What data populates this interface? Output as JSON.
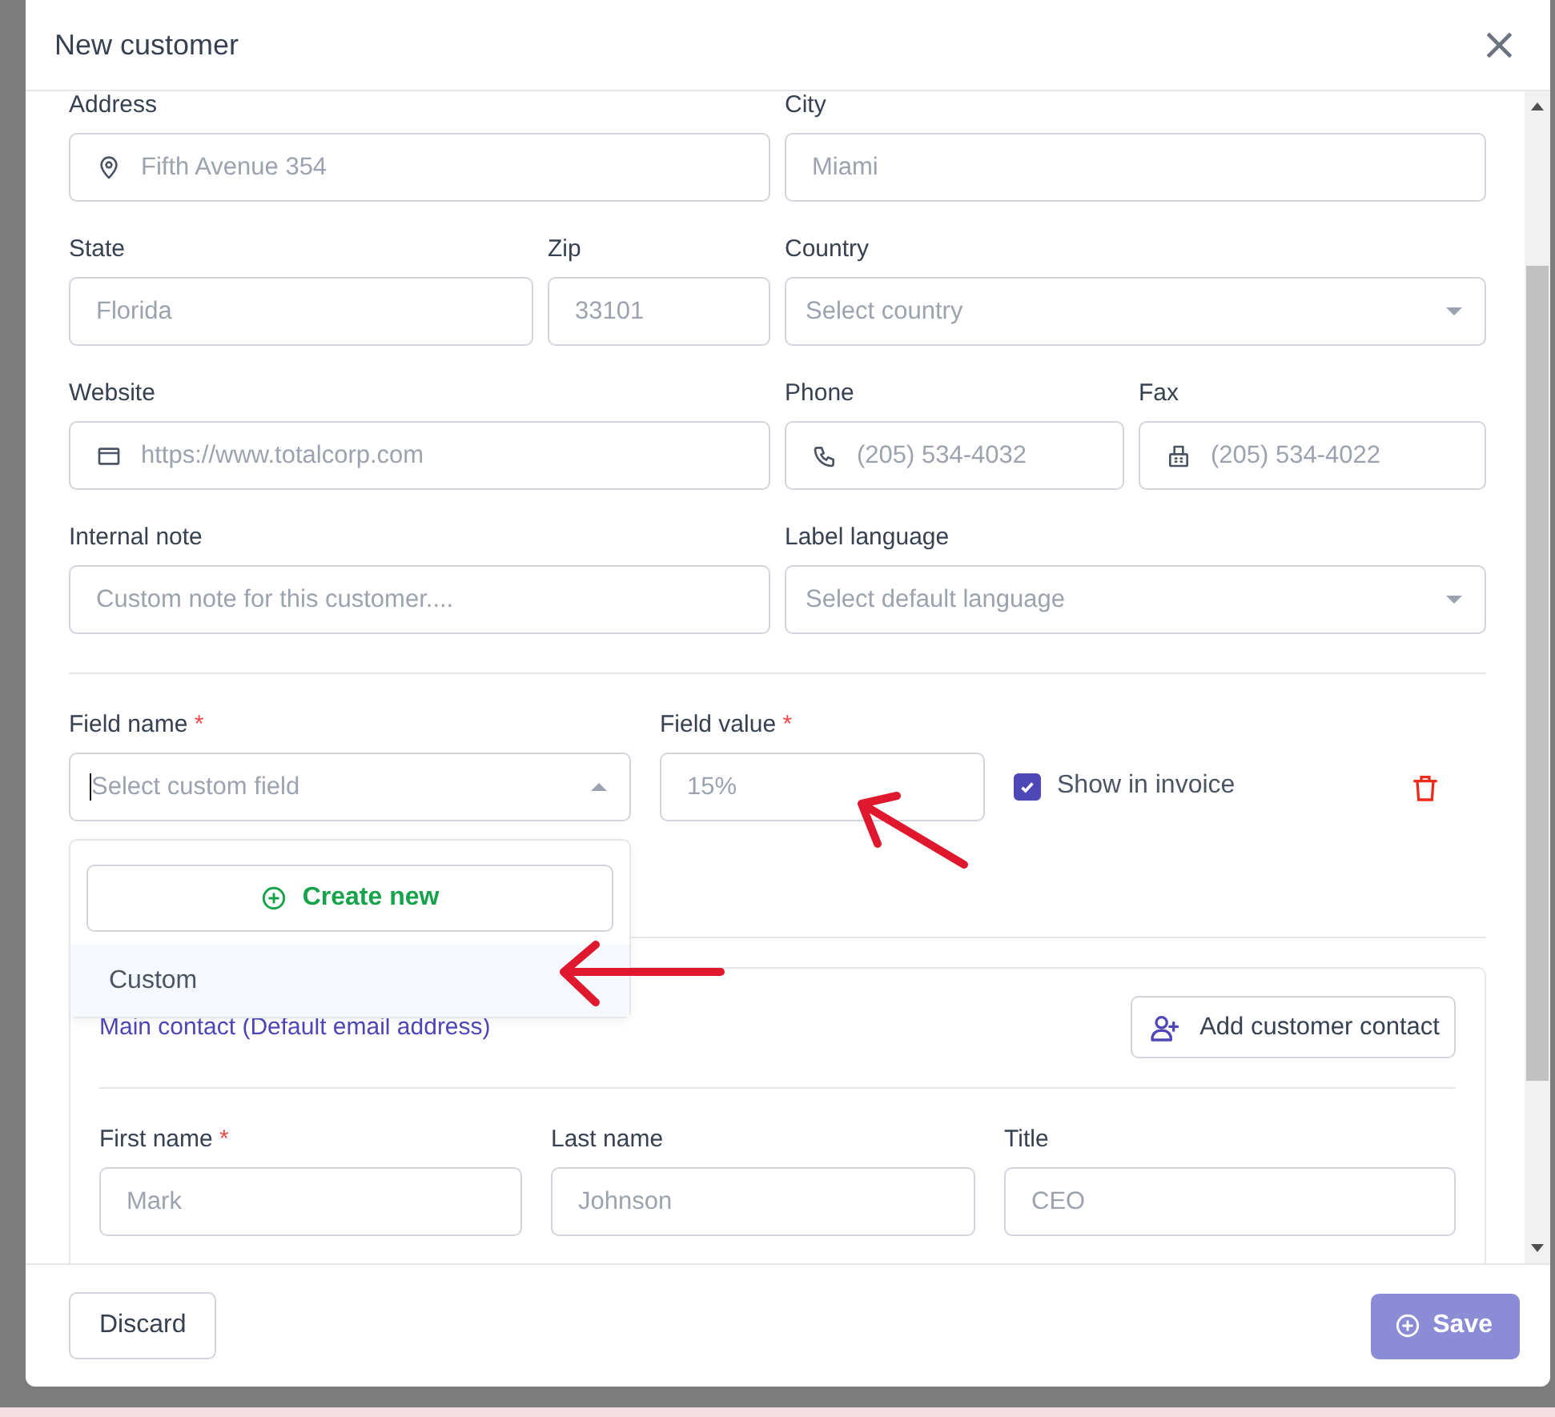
{
  "dialog": {
    "title": "New customer",
    "close": "×"
  },
  "fields": {
    "address": {
      "label": "Address",
      "placeholder": "Fifth Avenue 354"
    },
    "city": {
      "label": "City",
      "placeholder": "Miami"
    },
    "state": {
      "label": "State",
      "placeholder": "Florida"
    },
    "zip": {
      "label": "Zip",
      "placeholder": "33101"
    },
    "country": {
      "label": "Country",
      "placeholder": "Select country"
    },
    "website": {
      "label": "Website",
      "placeholder": "https://www.totalcorp.com"
    },
    "phone": {
      "label": "Phone",
      "placeholder": "(205) 534-4032"
    },
    "fax": {
      "label": "Fax",
      "placeholder": "(205) 534-4022"
    },
    "internal_note": {
      "label": "Internal note",
      "placeholder": "Custom note for this customer...."
    },
    "label_language": {
      "label": "Label language",
      "placeholder": "Select default language"
    }
  },
  "custom_field": {
    "name": {
      "label": "Field name",
      "required_mark": "*",
      "placeholder": "Select custom field"
    },
    "value": {
      "label": "Field value",
      "required_mark": "*",
      "placeholder": "15%"
    },
    "show_in_invoice": {
      "label": "Show in invoice",
      "checked": true
    },
    "dropdown": {
      "expanded": true,
      "create_label": "Create new",
      "options": [
        {
          "label": "Custom",
          "highlighted": true
        }
      ]
    }
  },
  "contact": {
    "main_contact_label": "Main contact (Default email address)",
    "add_button": "Add customer contact",
    "first_name": {
      "label": "First name",
      "required_mark": "*",
      "placeholder": "Mark"
    },
    "last_name": {
      "label": "Last name",
      "placeholder": "Johnson"
    },
    "title": {
      "label": "Title",
      "placeholder": "CEO"
    }
  },
  "footer": {
    "discard": "Discard",
    "save": {
      "label": "Save",
      "disabled": true
    }
  }
}
